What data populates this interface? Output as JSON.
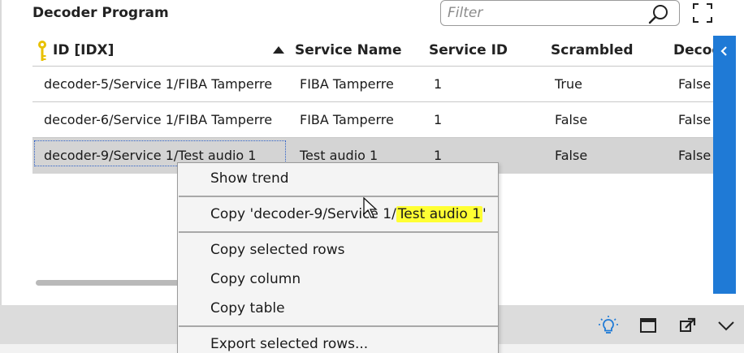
{
  "panel": {
    "title": "Decoder Program",
    "filter_placeholder": "Filter"
  },
  "table": {
    "columns": [
      {
        "label": "ID [IDX]",
        "key": true,
        "sort": "ascending"
      },
      {
        "label": "Service Name"
      },
      {
        "label": "Service ID"
      },
      {
        "label": "Scrambled"
      },
      {
        "label": "Decod"
      }
    ],
    "rows": [
      {
        "id": "decoder-5/Service 1/FIBA Tamperre",
        "service_name": "FIBA Tamperre",
        "service_id": "1",
        "scrambled": "True",
        "decoded": "False"
      },
      {
        "id": "decoder-6/Service 1/FIBA Tamperre",
        "service_name": "FIBA Tamperre",
        "service_id": "1",
        "scrambled": "False",
        "decoded": "False"
      },
      {
        "id": "decoder-9/Service 1/Test audio 1",
        "service_name": "Test audio 1",
        "service_id": "1",
        "scrambled": "False",
        "decoded": "False"
      }
    ],
    "selected_row": 2
  },
  "context_menu": {
    "show_trend": "Show trend",
    "copy_value_prefix": "Copy 'decoder-9/Service 1/",
    "copy_value_highlight": "Test audio 1",
    "copy_value_suffix": "'",
    "copy_selected_rows": "Copy selected rows",
    "copy_column": "Copy column",
    "copy_table": "Copy table",
    "export_selected_rows": "Export selected rows..."
  },
  "colors": {
    "accent": "#1f7ad6",
    "selection": "#d4d4d4",
    "highlight": "#ffff33",
    "key_icon": "#e8c100"
  },
  "icons": {
    "search": "search-icon",
    "fullscreen": "fullscreen-icon",
    "key": "key-icon",
    "sort": "sort-ascending-icon",
    "collapse": "chevron-left-icon",
    "lightbulb": "lightbulb-icon",
    "window": "maximize-window-icon",
    "popout": "popout-icon",
    "expand": "chevron-down-icon"
  }
}
